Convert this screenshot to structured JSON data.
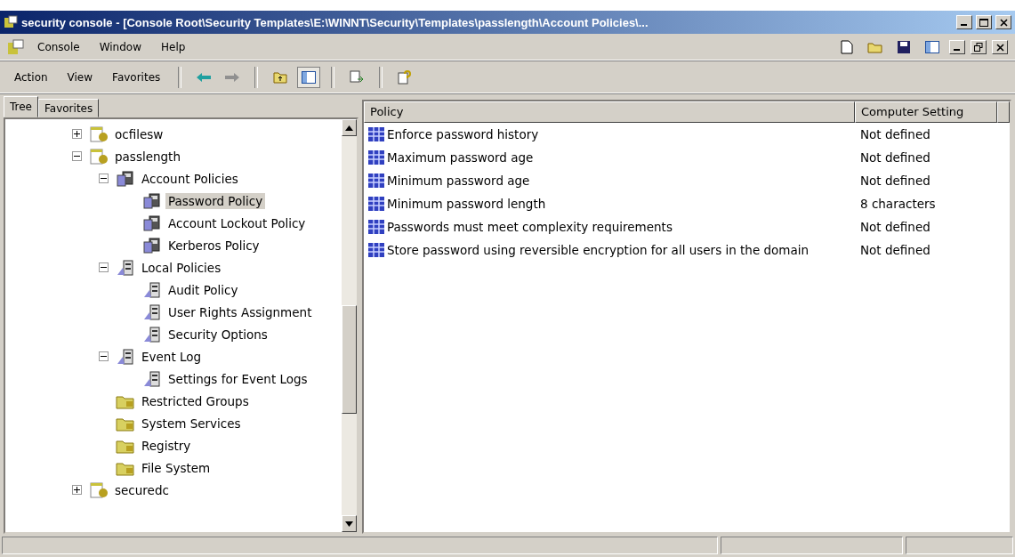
{
  "window": {
    "title": "security console - [Console Root\\Security Templates\\E:\\WINNT\\Security\\Templates\\passlength\\Account Policies\\..."
  },
  "menu": [
    "Console",
    "Window",
    "Help"
  ],
  "action_menu": [
    "Action",
    "View",
    "Favorites"
  ],
  "tabs": [
    {
      "label": "Tree",
      "selected": true
    },
    {
      "label": "Favorites",
      "selected": false
    }
  ],
  "tree": [
    {
      "label": "ocfilesw",
      "kind": "template",
      "expanded": false,
      "selected": false
    },
    {
      "label": "passlength",
      "kind": "template",
      "expanded": true,
      "selected": false,
      "children": [
        {
          "label": "Account Policies",
          "kind": "account",
          "expanded": true,
          "selected": false,
          "children": [
            {
              "label": "Password Policy",
              "kind": "account",
              "selected": true
            },
            {
              "label": "Account Lockout Policy",
              "kind": "account",
              "selected": false
            },
            {
              "label": "Kerberos Policy",
              "kind": "account",
              "selected": false
            }
          ]
        },
        {
          "label": "Local Policies",
          "kind": "local",
          "expanded": true,
          "selected": false,
          "children": [
            {
              "label": "Audit Policy",
              "kind": "local",
              "selected": false
            },
            {
              "label": "User Rights Assignment",
              "kind": "local",
              "selected": false
            },
            {
              "label": "Security Options",
              "kind": "local",
              "selected": false
            }
          ]
        },
        {
          "label": "Event Log",
          "kind": "local",
          "expanded": true,
          "selected": false,
          "children": [
            {
              "label": "Settings for Event Logs",
              "kind": "local",
              "selected": false
            }
          ]
        },
        {
          "label": "Restricted Groups",
          "kind": "folder",
          "selected": false
        },
        {
          "label": "System Services",
          "kind": "folder",
          "selected": false
        },
        {
          "label": "Registry",
          "kind": "folder",
          "selected": false
        },
        {
          "label": "File System",
          "kind": "folder",
          "selected": false
        }
      ]
    },
    {
      "label": "securedc",
      "kind": "template",
      "expanded": false,
      "selected": false
    }
  ],
  "table": {
    "columns": [
      "Policy",
      "Computer Setting"
    ],
    "rows": [
      {
        "policy": "Enforce password history",
        "setting": "Not defined"
      },
      {
        "policy": "Maximum password age",
        "setting": "Not defined"
      },
      {
        "policy": "Minimum password age",
        "setting": "Not defined"
      },
      {
        "policy": "Minimum password length",
        "setting": "8 characters"
      },
      {
        "policy": "Passwords must meet complexity requirements",
        "setting": "Not defined"
      },
      {
        "policy": "Store password using reversible encryption for all users in the domain",
        "setting": "Not defined"
      }
    ]
  }
}
